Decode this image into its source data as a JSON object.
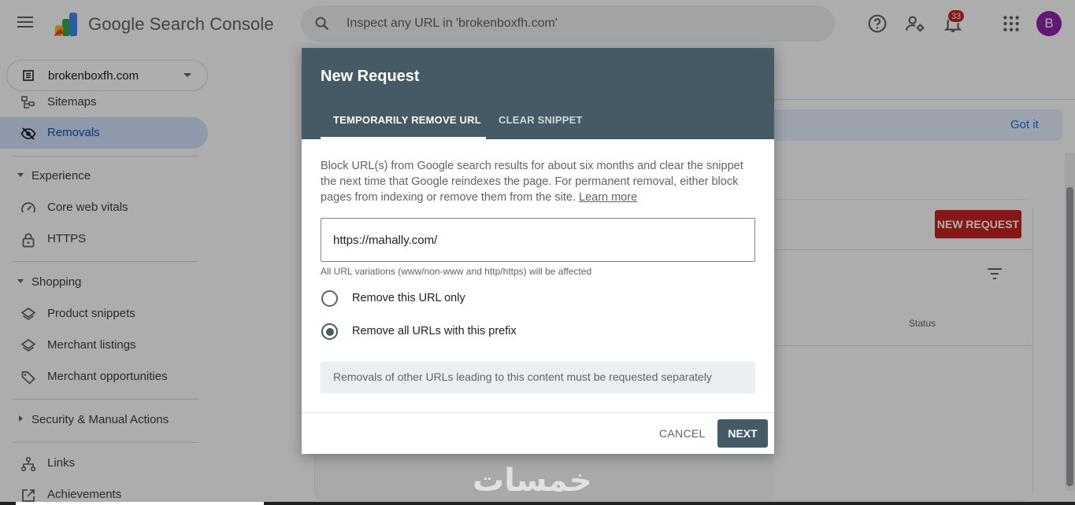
{
  "header": {
    "app_title": "Google Search Console",
    "search_placeholder": "Inspect any URL in 'brokenboxfh.com'",
    "notification_count": "33",
    "avatar_letter": "B",
    "icons": [
      "menu-icon",
      "search-console-logo",
      "search-icon",
      "help-icon",
      "manage-users-icon",
      "notifications-icon",
      "apps-icon"
    ]
  },
  "sidebar": {
    "property": "brokenboxfh.com",
    "items": [
      {
        "label": "Sitemaps",
        "icon": "sitemap-icon"
      },
      {
        "label": "Removals",
        "icon": "eye-off-icon",
        "active": true
      }
    ],
    "sections": [
      {
        "label": "Experience",
        "expanded": true,
        "items": [
          {
            "label": "Core web vitals",
            "icon": "speedometer-icon"
          },
          {
            "label": "HTTPS",
            "icon": "lock-icon"
          }
        ]
      },
      {
        "label": "Shopping",
        "expanded": true,
        "items": [
          {
            "label": "Product snippets",
            "icon": "layers-icon"
          },
          {
            "label": "Merchant listings",
            "icon": "layers-icon"
          },
          {
            "label": "Merchant opportunities",
            "icon": "tag-icon"
          }
        ]
      },
      {
        "label": "Security & Manual Actions",
        "expanded": false,
        "items": []
      }
    ],
    "bottom_items": [
      {
        "label": "Links",
        "icon": "links-icon"
      },
      {
        "label": "Achievements",
        "icon": "external-icon"
      }
    ]
  },
  "background": {
    "got_it": "Got it",
    "new_request_button": "NEW REQUEST",
    "status_column": "Status"
  },
  "dialog": {
    "title": "New Request",
    "tabs": [
      "TEMPORARILY REMOVE URL",
      "CLEAR SNIPPET"
    ],
    "active_tab": "TEMPORARILY REMOVE URL",
    "description": "Block URL(s) from Google search results for about six months and clear the snippet the next time that Google reindexes the page. For permanent removal, either block pages from indexing or remove them from the site.",
    "learn_more": "Learn more",
    "url_value": "https://mahally.com/",
    "url_hint": "All URL variations (www/non-www and http/https) will be affected",
    "options": [
      {
        "label": "Remove this URL only",
        "selected": false
      },
      {
        "label": "Remove all URLs with this prefix",
        "selected": true
      }
    ],
    "note": "Removals of other URLs leading to this content must be requested separately",
    "cancel": "CANCEL",
    "next": "NEXT"
  },
  "watermark": "خمسات",
  "colors": {
    "dialog_header": "#455a64",
    "active_nav_bg": "#d2e3fc",
    "new_request_red": "#c5221f",
    "notification_badge": "#c5221f",
    "avatar": "#8e24aa",
    "link_blue": "#1a73e8"
  }
}
